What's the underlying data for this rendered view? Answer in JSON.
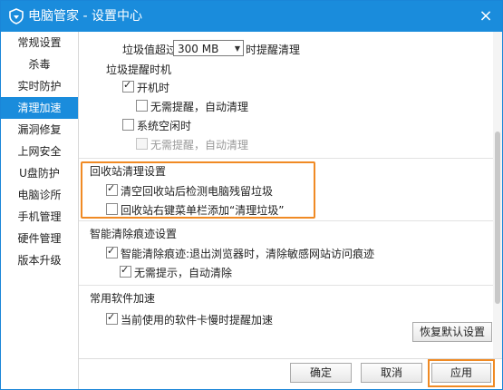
{
  "window": {
    "title": "电脑管家 - 设置中心",
    "close_label": "×"
  },
  "sidebar": {
    "items": [
      {
        "label": "常规设置"
      },
      {
        "label": "杀毒"
      },
      {
        "label": "实时防护"
      },
      {
        "label": "清理加速"
      },
      {
        "label": "漏洞修复"
      },
      {
        "label": "上网安全"
      },
      {
        "label": "U盘防护"
      },
      {
        "label": "电脑诊所"
      },
      {
        "label": "手机管理"
      },
      {
        "label": "硬件管理"
      },
      {
        "label": "版本升级"
      }
    ],
    "active_index": 3
  },
  "content": {
    "threshold": {
      "prefix": "垃圾值超过",
      "value": "300 MB",
      "suffix": "时提醒清理"
    },
    "remind_timing": {
      "title": "垃圾提醒时机",
      "on_boot": {
        "label": "开机时",
        "checked": true
      },
      "on_boot_auto": {
        "label": "无需提醒，自动清理",
        "checked": false
      },
      "on_idle": {
        "label": "系统空闲时",
        "checked": false
      },
      "on_idle_auto": {
        "label": "无需提醒，自动清理",
        "checked": false,
        "disabled": true
      }
    },
    "recycle_bin": {
      "title": "回收站清理设置",
      "detect": {
        "label": "清空回收站后检测电脑残留垃圾",
        "checked": true
      },
      "context_menu": {
        "label": "回收站右键菜单栏添加“清理垃圾”",
        "checked": false
      }
    },
    "smart_clean": {
      "title": "智能清除痕迹设置",
      "enable": {
        "label": "智能清除痕迹:退出浏览器时，清除敏感网站访问痕迹",
        "checked": true
      },
      "no_prompt": {
        "label": "无需提示，自动清除",
        "checked": true
      }
    },
    "software_speed": {
      "title": "常用软件加速",
      "remind": {
        "label": "当前使用的软件卡慢时提醒加速",
        "checked": true
      }
    },
    "restore_defaults_label": "恢复默认设置"
  },
  "footer": {
    "ok_label": "确定",
    "cancel_label": "取消",
    "apply_label": "应用"
  },
  "colors": {
    "accent": "#1a8cdc",
    "highlight": "#f08a24"
  }
}
